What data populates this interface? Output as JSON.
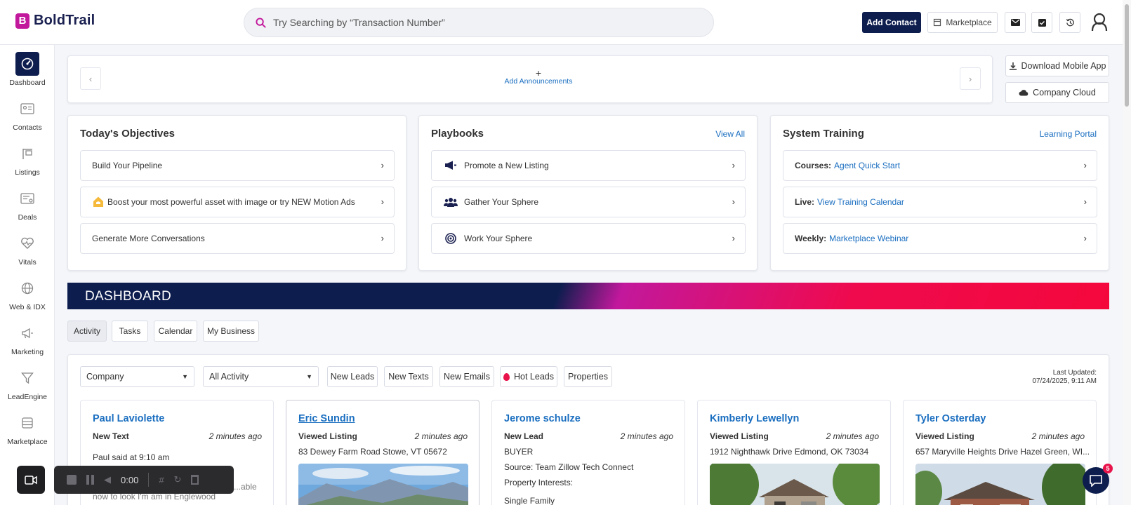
{
  "app": {
    "logo_letter": "B",
    "logo_text": "BoldTrail",
    "brand_color": "#0d1d4e",
    "accent_color": "#c2189c"
  },
  "search": {
    "placeholder": "Try Searching by “Transaction Number”"
  },
  "topbar": {
    "add_contact": "Add Contact",
    "marketplace": "Marketplace"
  },
  "sidebar": {
    "items": [
      {
        "label": "Dashboard",
        "icon": "dashboard-gauge-icon"
      },
      {
        "label": "Contacts",
        "icon": "contact-card-icon"
      },
      {
        "label": "Listings",
        "icon": "listing-sign-icon"
      },
      {
        "label": "Deals",
        "icon": "deals-card-icon"
      },
      {
        "label": "Vitals",
        "icon": "heart-pulse-icon"
      },
      {
        "label": "Web & IDX",
        "icon": "globe-icon"
      },
      {
        "label": "Marketing",
        "icon": "megaphone-icon"
      },
      {
        "label": "LeadEngine",
        "icon": "funnel-icon"
      },
      {
        "label": "Marketplace",
        "icon": "store-icon"
      }
    ]
  },
  "announcements": {
    "add_label": "Add Announcements"
  },
  "side_buttons": {
    "download_app": "Download Mobile App",
    "company_cloud": "Company Cloud"
  },
  "objectives": {
    "title": "Today's Objectives",
    "items": [
      "Build Your Pipeline",
      "Boost your most powerful asset with image or try NEW Motion Ads",
      "Generate More Conversations"
    ]
  },
  "playbooks": {
    "title": "Playbooks",
    "view_all": "View All",
    "items": [
      "Promote a New Listing",
      "Gather Your Sphere",
      "Work Your Sphere"
    ]
  },
  "training": {
    "title": "System Training",
    "link": "Learning Portal",
    "items": [
      {
        "prefix": "Courses:",
        "link": "Agent Quick Start"
      },
      {
        "prefix": "Live:",
        "link": "View Training Calendar"
      },
      {
        "prefix": "Weekly:",
        "link": "Marketplace Webinar"
      }
    ]
  },
  "dashboard": {
    "banner_title": "DASHBOARD"
  },
  "tabs": [
    "Activity",
    "Tasks",
    "Calendar",
    "My Business"
  ],
  "filters": {
    "company_select": "Company",
    "activity_select": "All Activity",
    "buttons": [
      "New Leads",
      "New Texts",
      "New Emails",
      "Hot Leads",
      "Properties"
    ],
    "last_updated_label": "Last Updated:",
    "last_updated_value": "07/24/2025, 9:11 AM"
  },
  "cards": [
    {
      "name": "Paul Laviolette",
      "type": "New Text",
      "time": "2 minutes ago",
      "line1": "Paul said at 9:10 am",
      "line2": "...able",
      "line3": "now to look I'm am in Englewood"
    },
    {
      "name": "Eric Sundin",
      "type": "Viewed Listing",
      "time": "2 minutes ago",
      "line1": "83 Dewey Farm Road Stowe, VT 05672"
    },
    {
      "name": "Jerome schulze",
      "type": "New Lead",
      "time": "2 minutes ago",
      "line1": "BUYER",
      "line2": "Source: Team Zillow Tech Connect",
      "line3": "Property Interests:",
      "line4": "Single Family"
    },
    {
      "name": "Kimberly Lewellyn",
      "type": "Viewed Listing",
      "time": "2 minutes ago",
      "line1": "1912 Nighthawk Drive Edmond, OK 73034"
    },
    {
      "name": "Tyler Osterday",
      "type": "Viewed Listing",
      "time": "2 minutes ago",
      "line1": "657 Maryville Heights Drive Hazel Green, WI..."
    }
  ],
  "recorder": {
    "time": "0:00"
  },
  "chat": {
    "badge_count": "5"
  }
}
